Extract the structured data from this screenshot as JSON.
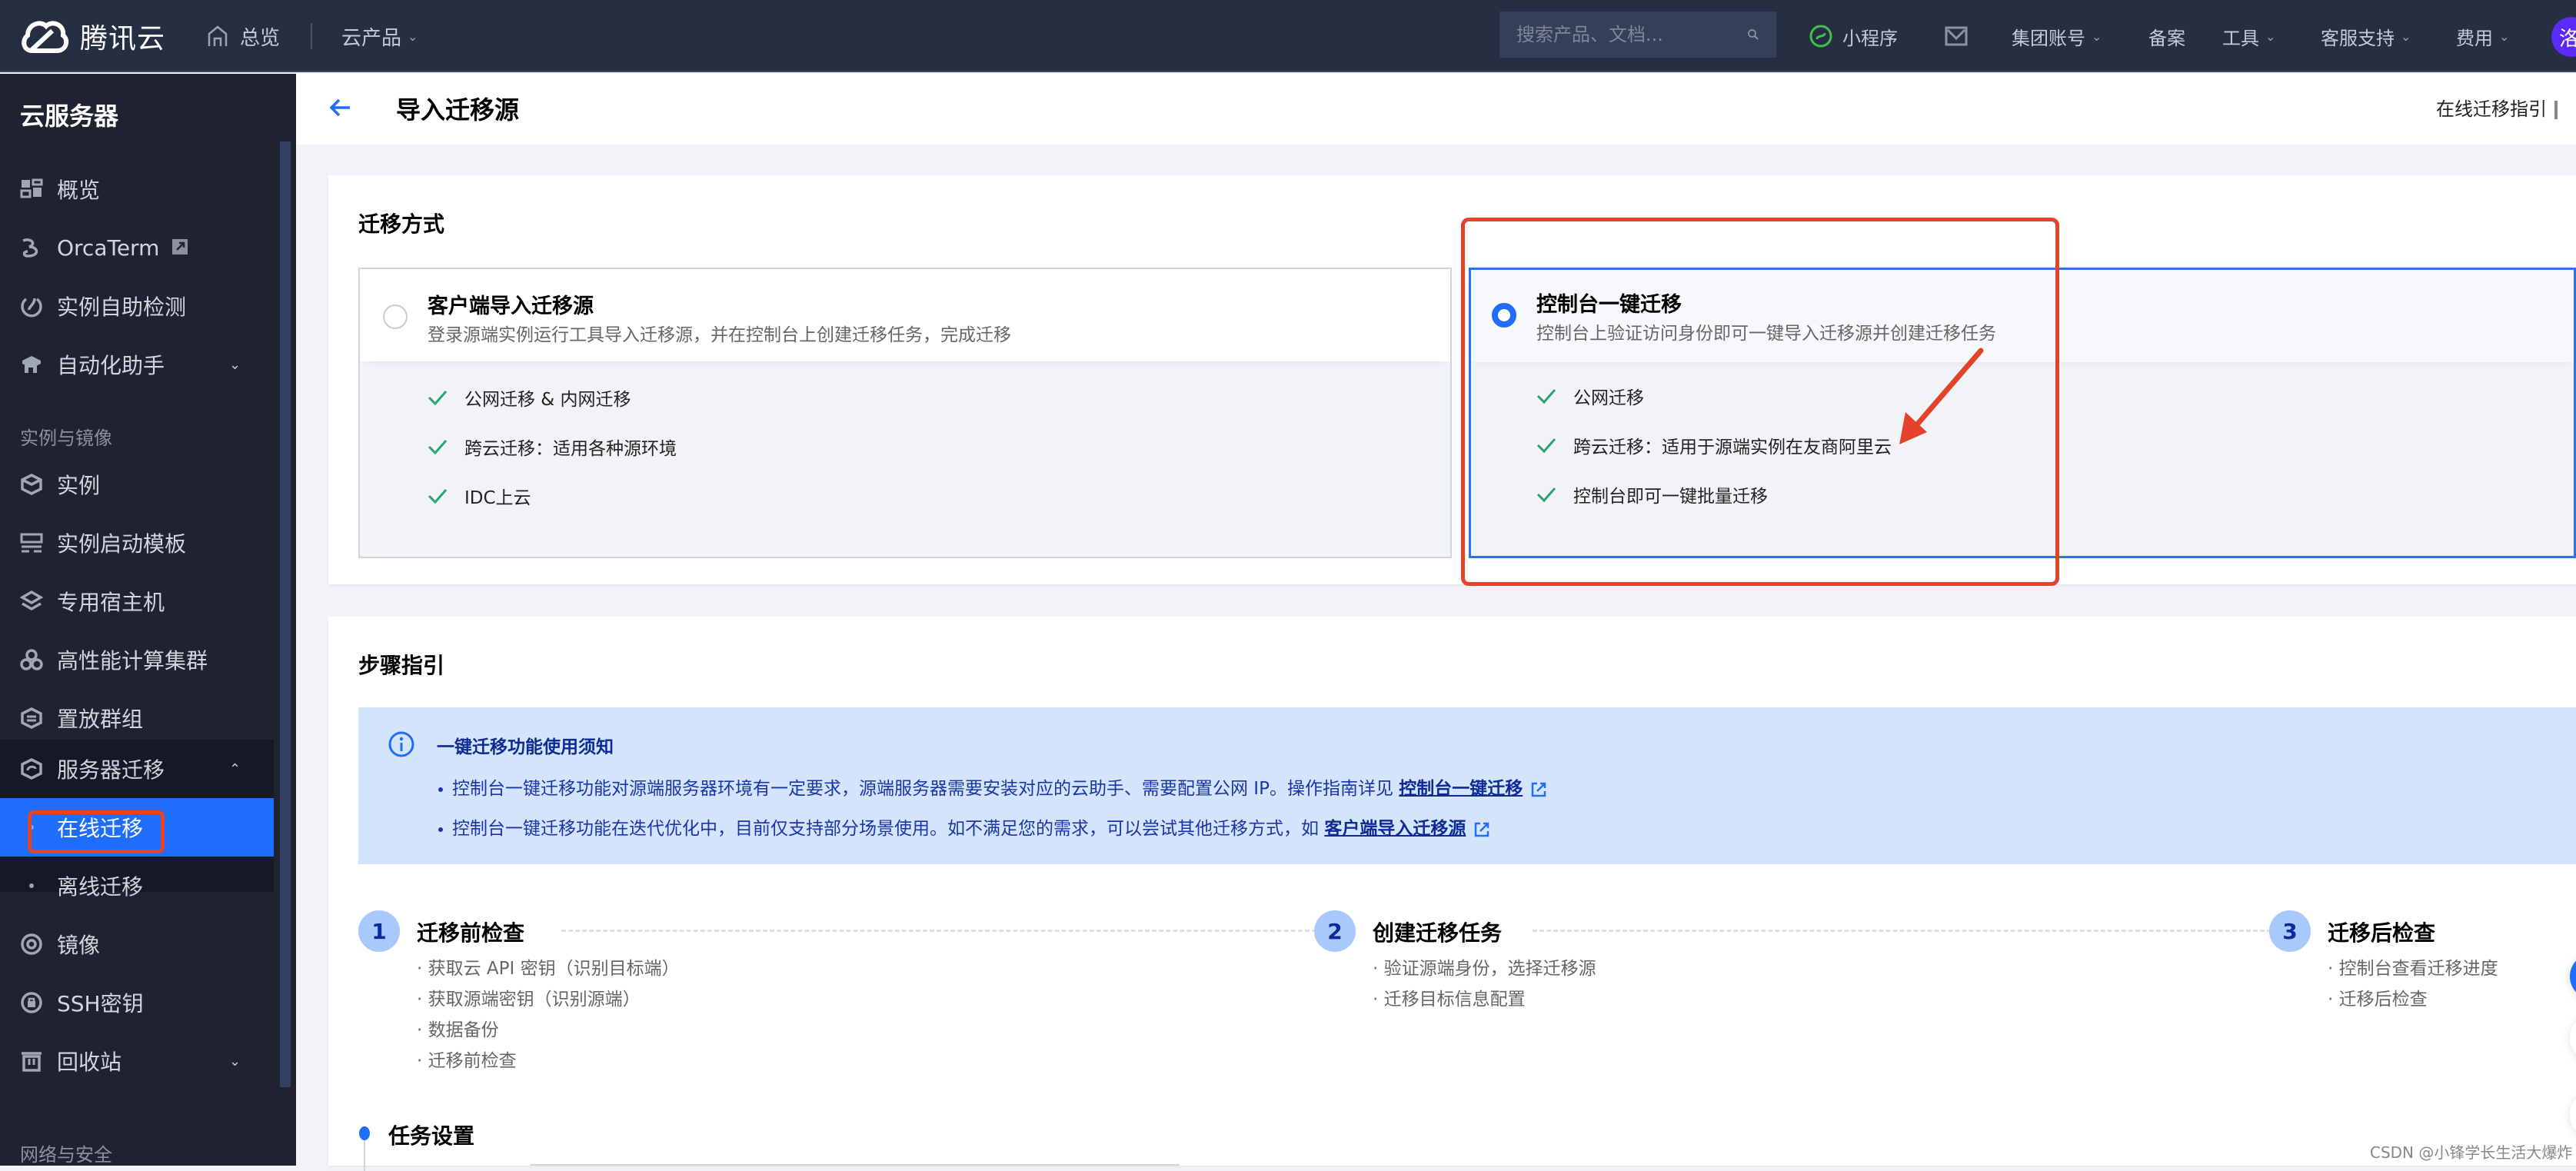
{
  "topbar": {
    "logo_text": "腾讯云",
    "home_label": "总览",
    "products_label": "云产品",
    "search_placeholder": "搜索产品、文档...",
    "mini_program": "小程序",
    "group_account": "集团账号",
    "filing": "备案",
    "tools": "工具",
    "support": "客服支持",
    "billing": "费用",
    "avatar_char": "洛",
    "accent_color": "#1f6dfb"
  },
  "sidebar": {
    "title": "云服务器",
    "items": [
      {
        "label": "概览",
        "icon": "dashboard-icon"
      },
      {
        "label": "OrcaTerm",
        "icon": "orcaterm-icon",
        "external": true
      },
      {
        "label": "实例自助检测",
        "icon": "self-check-icon"
      },
      {
        "label": "自动化助手",
        "icon": "automation-icon",
        "expandable": true
      }
    ],
    "group_instances": "实例与镜像",
    "instance_items": [
      {
        "label": "实例",
        "icon": "instance-icon"
      },
      {
        "label": "实例启动模板",
        "icon": "template-icon"
      },
      {
        "label": "专用宿主机",
        "icon": "dedicated-host-icon"
      },
      {
        "label": "高性能计算集群",
        "icon": "hpc-cluster-icon"
      },
      {
        "label": "置放群组",
        "icon": "placement-group-icon"
      },
      {
        "label": "服务器迁移",
        "icon": "migration-icon",
        "expanded": true
      }
    ],
    "migration_sub": [
      {
        "label": "在线迁移",
        "active": true
      },
      {
        "label": "离线迁移",
        "active": false
      }
    ],
    "more_items": [
      {
        "label": "镜像",
        "icon": "image-icon"
      },
      {
        "label": "SSH密钥",
        "icon": "ssh-key-icon"
      },
      {
        "label": "回收站",
        "icon": "recycle-bin-icon",
        "expandable": true
      }
    ],
    "group_network": "网络与安全"
  },
  "page": {
    "title": "导入迁移源",
    "guide_link": "在线迁移指引"
  },
  "migration_method": {
    "title": "迁移方式",
    "options": [
      {
        "title": "客户端导入迁移源",
        "desc": "登录源端实例运行工具导入迁移源，并在控制台上创建迁移任务，完成迁移",
        "selected": false,
        "features": [
          "公网迁移 & 内网迁移",
          "跨云迁移：适用各种源环境",
          "IDC上云"
        ]
      },
      {
        "title": "控制台一键迁移",
        "desc": "控制台上验证访问身份即可一键导入迁移源并创建迁移任务",
        "selected": true,
        "features": [
          "公网迁移",
          "跨云迁移：适用于源端实例在友商阿里云",
          "控制台即可一键批量迁移"
        ]
      }
    ]
  },
  "steps_guide": {
    "title": "步骤指引",
    "notice": {
      "title": "一键迁移功能使用须知",
      "line1_text": "控制台一键迁移功能对源端服务器环境有一定要求，源端服务器需要安装对应的云助手、需要配置公网 IP。操作指南详见 ",
      "line1_link": "控制台一键迁移",
      "line2_text": "控制台一键迁移功能在迭代优化中，目前仅支持部分场景使用。如不满足您的需求，可以尝试其他迁移方式，如 ",
      "line2_link": "客户端导入迁移源"
    },
    "steps": [
      {
        "num": "1",
        "title": "迁移前检查",
        "items": [
          "· 获取云 API 密钥（识别目标端）",
          "· 获取源端密钥（识别源端）",
          "· 数据备份",
          "· 迁移前检查"
        ]
      },
      {
        "num": "2",
        "title": "创建迁移任务",
        "items": [
          "· 验证源端身份，选择迁移源",
          "· 迁移目标信息配置"
        ]
      },
      {
        "num": "3",
        "title": "迁移后检查",
        "items": [
          "· 控制台查看迁移进度",
          "· 迁移后检查"
        ]
      }
    ]
  },
  "task_settings": {
    "title": "任务设置"
  },
  "watermark": "CSDN @小锋学长生活大爆炸"
}
